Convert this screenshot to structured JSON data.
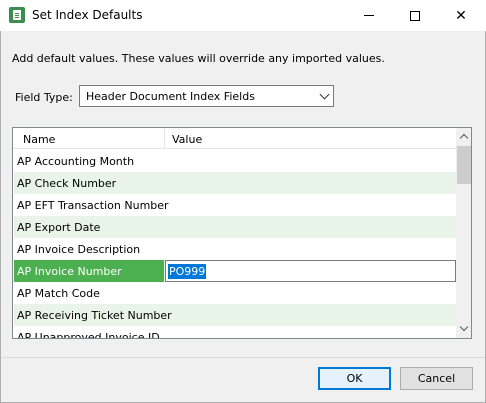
{
  "window": {
    "title": "Set Index Defaults",
    "minimize_icon": "minimize-icon",
    "maximize_icon": "maximize-icon",
    "close_glyph": "✕"
  },
  "instruction": "Add default values. These values will override any imported values.",
  "field_type": {
    "label": "Field Type:",
    "selected": "Header Document Index Fields"
  },
  "grid": {
    "columns": [
      "Name",
      "Value"
    ],
    "rows": [
      {
        "name": "AP Accounting Month",
        "value": ""
      },
      {
        "name": "AP Check Number",
        "value": ""
      },
      {
        "name": "AP EFT Transaction Number",
        "value": ""
      },
      {
        "name": "AP Export Date",
        "value": ""
      },
      {
        "name": "AP Invoice Description",
        "value": ""
      },
      {
        "name": "AP Invoice Number",
        "value": "PO999"
      },
      {
        "name": "AP Match Code",
        "value": ""
      },
      {
        "name": "AP Receiving Ticket Number",
        "value": ""
      },
      {
        "name": "AP Unapproved Invoice ID",
        "value": ""
      }
    ],
    "selected_row": "AP Invoice Number",
    "alt_row_color": "#e8f4e8",
    "selected_color": "#4caf50"
  },
  "buttons": {
    "ok": "OK",
    "cancel": "Cancel"
  },
  "colors": {
    "accent": "#0078d7"
  }
}
